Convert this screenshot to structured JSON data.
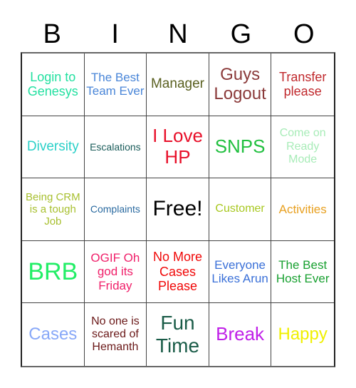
{
  "header": {
    "letters": [
      "B",
      "I",
      "N",
      "G",
      "O"
    ]
  },
  "cells": [
    {
      "text": "Login to Genesys",
      "color": "#22e0a0",
      "size": 18
    },
    {
      "text": "The Best Team Ever",
      "color": "#4a86d8",
      "size": 17
    },
    {
      "text": "Manager",
      "color": "#5a6020",
      "size": 19
    },
    {
      "text": "Guys Logout",
      "color": "#8b3a3a",
      "size": 24
    },
    {
      "text": "Transfer please",
      "color": "#c0282c",
      "size": 18
    },
    {
      "text": "Diversity",
      "color": "#2ad0c8",
      "size": 19
    },
    {
      "text": "Escalations",
      "color": "#1a5c5a",
      "size": 14
    },
    {
      "text": "I Love HP",
      "color": "#e8102a",
      "size": 26
    },
    {
      "text": "SNPS",
      "color": "#22c040",
      "size": 26
    },
    {
      "text": "Come on Ready Mode",
      "color": "#a8ecb8",
      "size": 16
    },
    {
      "text": "Being CRM is a tough Job",
      "color": "#a8c030",
      "size": 15
    },
    {
      "text": "Complaints",
      "color": "#2a6aa0",
      "size": 14
    },
    {
      "text": "Free!",
      "color": "#000000",
      "size": 30
    },
    {
      "text": "Customer",
      "color": "#a8c820",
      "size": 16
    },
    {
      "text": "Activities",
      "color": "#e8a020",
      "size": 17
    },
    {
      "text": "BRB",
      "color": "#22ee66",
      "size": 34
    },
    {
      "text": "OGIF Oh god its Friday",
      "color": "#f0206a",
      "size": 17
    },
    {
      "text": "No More Cases Please",
      "color": "#f00808",
      "size": 18
    },
    {
      "text": "Everyone Likes Arun",
      "color": "#3a70d8",
      "size": 17
    },
    {
      "text": "The Best Host Ever",
      "color": "#18a030",
      "size": 17
    },
    {
      "text": "Cases",
      "color": "#88a8f8",
      "size": 24
    },
    {
      "text": "No one is scared of Hemanth",
      "color": "#6a1818",
      "size": 16
    },
    {
      "text": "Fun Time",
      "color": "#1a5c48",
      "size": 28
    },
    {
      "text": "Break",
      "color": "#c020e8",
      "size": 26
    },
    {
      "text": "Happy",
      "color": "#f0f000",
      "size": 24
    }
  ]
}
